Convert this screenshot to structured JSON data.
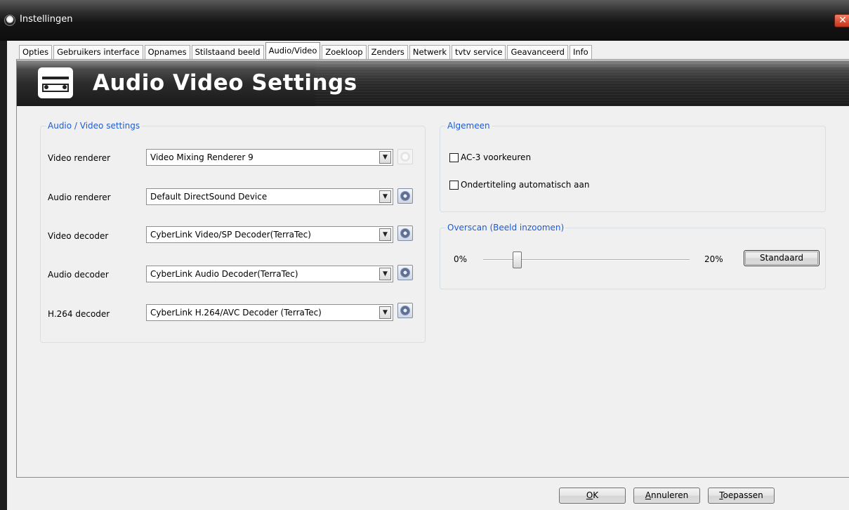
{
  "window": {
    "title": "Instellingen",
    "close_glyph": "✕"
  },
  "tabs": [
    {
      "label": "Opties"
    },
    {
      "label": "Gebruikers interface"
    },
    {
      "label": "Opnames"
    },
    {
      "label": "Stilstaand beeld"
    },
    {
      "label": "Audio/Video",
      "active": true
    },
    {
      "label": "Zoekloop"
    },
    {
      "label": "Zenders"
    },
    {
      "label": "Netwerk"
    },
    {
      "label": "tvtv service"
    },
    {
      "label": "Geavanceerd"
    },
    {
      "label": "Info"
    }
  ],
  "banner": {
    "title": "Audio Video Settings",
    "icon": "audio-video-device-icon"
  },
  "av_group": {
    "legend": "Audio / Video settings",
    "rows": [
      {
        "label": "Video renderer",
        "value": "Video Mixing Renderer 9",
        "settings_enabled": false
      },
      {
        "label": "Audio renderer",
        "value": "Default DirectSound Device",
        "settings_enabled": true
      },
      {
        "label": "Video decoder",
        "value": "CyberLink Video/SP Decoder(TerraTec)",
        "settings_enabled": true
      },
      {
        "label": "Audio decoder",
        "value": "CyberLink Audio Decoder(TerraTec)",
        "settings_enabled": true
      },
      {
        "label": "H.264 decoder",
        "value": "CyberLink H.264/AVC Decoder (TerraTec)",
        "settings_enabled": true
      }
    ]
  },
  "general_group": {
    "legend": "Algemeen",
    "ac3": {
      "label": "AC-3 voorkeuren",
      "checked": false
    },
    "subtitles": {
      "label": "Ondertiteling automatisch aan",
      "checked": false
    }
  },
  "overscan_group": {
    "legend": "Overscan (Beeld inzoomen)",
    "min_label": "0%",
    "max_label": "20%",
    "value_fraction": 0.15,
    "default_button": "Standaard"
  },
  "footer": {
    "ok": {
      "label": "OK",
      "accel": "O"
    },
    "cancel": {
      "label": "Annuleren",
      "accel": "A"
    },
    "apply": {
      "label": "Toepassen",
      "accel": "T"
    }
  },
  "colors": {
    "legend": "#1d5bd4",
    "close_button": "#d9452a"
  }
}
